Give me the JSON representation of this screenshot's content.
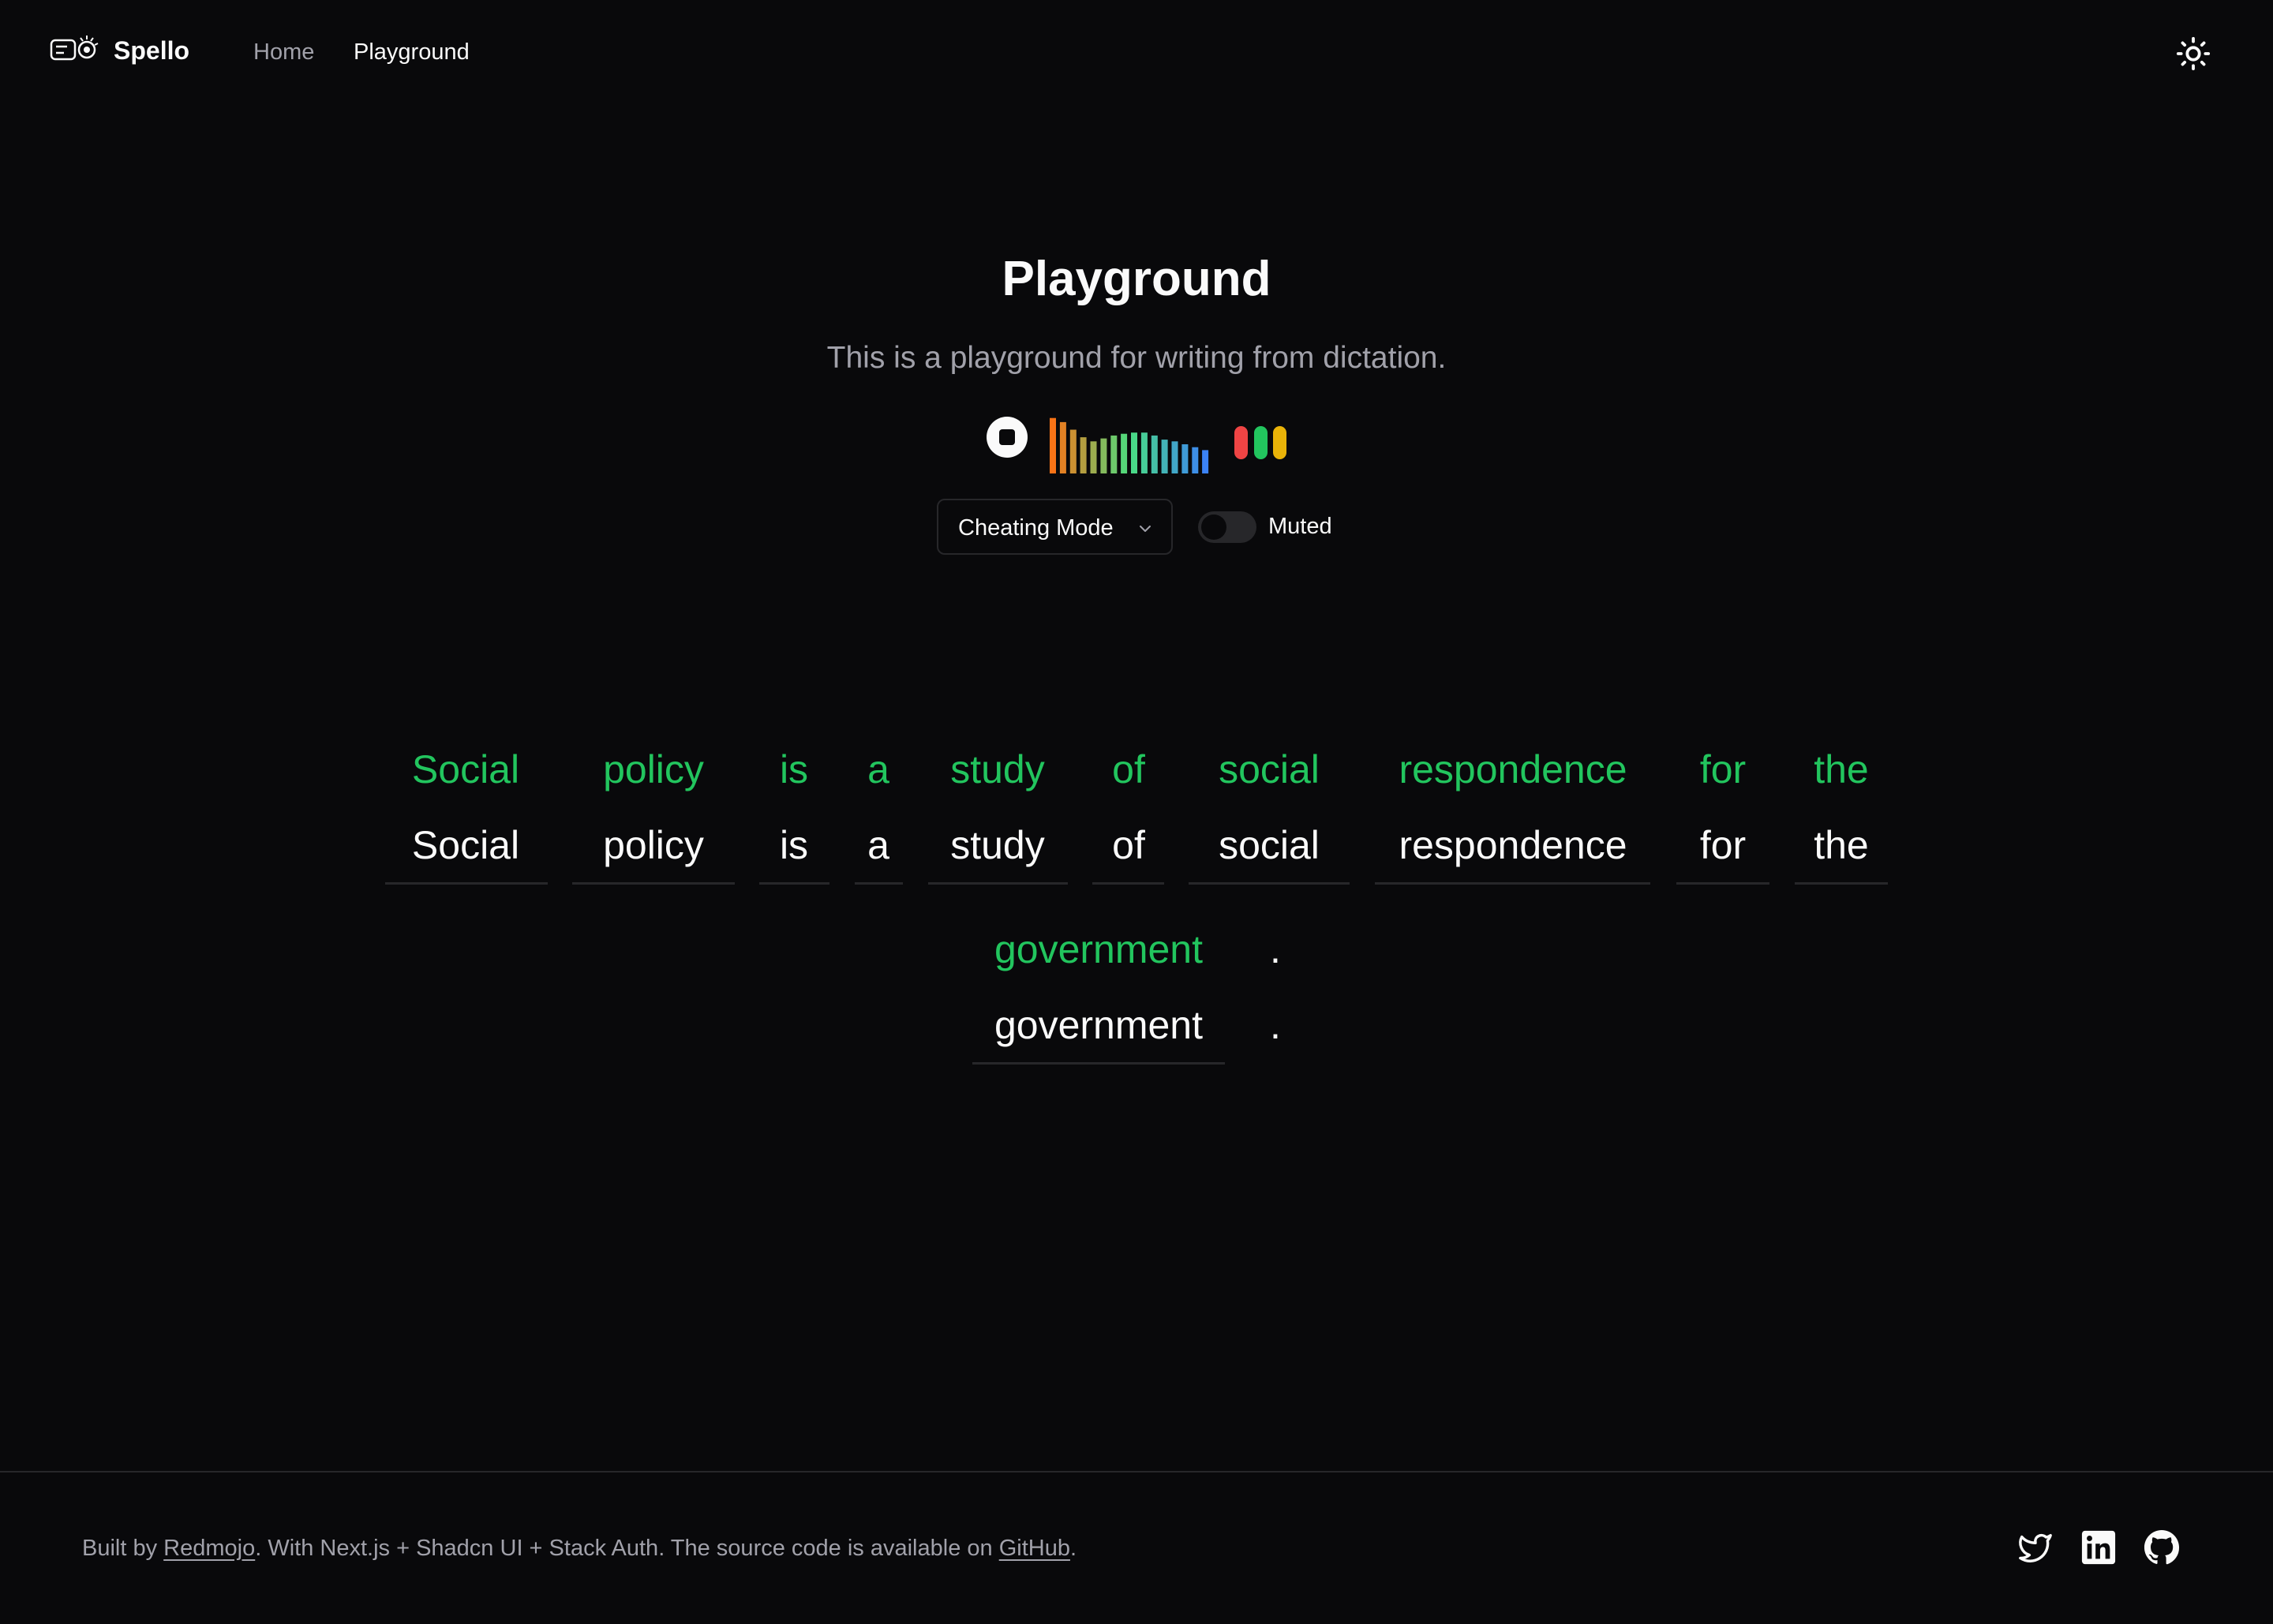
{
  "header": {
    "brand": "Spello",
    "nav": [
      {
        "label": "Home",
        "active": false
      },
      {
        "label": "Playground",
        "active": true
      }
    ],
    "theme_toggle_icon": "sun-icon"
  },
  "hero": {
    "title": "Playground",
    "subtitle": "This is a playground for writing from dictation."
  },
  "controls": {
    "stop_icon": "stop-icon",
    "visualizer_bar_levels": [
      0.95,
      0.88,
      0.75,
      0.62,
      0.55,
      0.6,
      0.65,
      0.68,
      0.7,
      0.7,
      0.65,
      0.58,
      0.55,
      0.5,
      0.45,
      0.4
    ],
    "status_dots": [
      {
        "color": "#ef4444"
      },
      {
        "color": "#22c55e"
      },
      {
        "color": "#eab308"
      }
    ],
    "mode_select": {
      "value": "Cheating Mode",
      "icon": "chevron-down-icon"
    },
    "muted_switch": {
      "label": "Muted",
      "on": false
    }
  },
  "dictation": {
    "words": [
      {
        "hint": "Social",
        "typed": "Social"
      },
      {
        "hint": "policy",
        "typed": "policy"
      },
      {
        "hint": "is",
        "typed": "is"
      },
      {
        "hint": "a",
        "typed": "a"
      },
      {
        "hint": "study",
        "typed": "study"
      },
      {
        "hint": "of",
        "typed": "of"
      },
      {
        "hint": "social",
        "typed": "social"
      },
      {
        "hint": "respondence",
        "typed": "respondence"
      },
      {
        "hint": "for",
        "typed": "for"
      },
      {
        "hint": "the",
        "typed": "the"
      },
      {
        "hint": "government",
        "typed": "government"
      }
    ],
    "punctuation": "."
  },
  "footer": {
    "prefix": "Built by ",
    "author_link": "Redmojo",
    "middle": ". With Next.js + Shadcn UI + Stack Auth. The source code is available on ",
    "source_link": "GitHub",
    "suffix": ".",
    "social_icons": [
      "twitter-icon",
      "linkedin-icon",
      "github-icon"
    ]
  },
  "colors": {
    "background": "#09090b",
    "correct": "#22c55e",
    "muted_text": "#a1a1aa",
    "border": "#27272a"
  }
}
